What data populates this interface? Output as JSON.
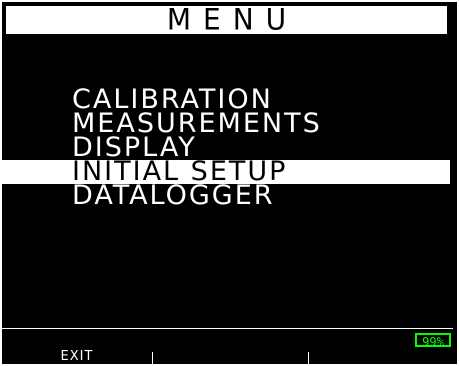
{
  "screen": {
    "title": "MENU",
    "menu_items": [
      {
        "label": "CALIBRATION"
      },
      {
        "label": "MEASUREMENTS"
      },
      {
        "label": "DISPLAY"
      },
      {
        "label": "INITIAL SETUP"
      },
      {
        "label": "DATALOGGER"
      }
    ],
    "selected_index": 3,
    "battery": "99%",
    "softkeys": [
      {
        "label": "EXIT"
      },
      {
        "label": ""
      },
      {
        "label": ""
      }
    ]
  },
  "colors": {
    "background": "#000000",
    "foreground": "#ffffff",
    "highlight_bg": "#ffffff",
    "highlight_fg": "#000000",
    "battery": "#00ff00"
  }
}
